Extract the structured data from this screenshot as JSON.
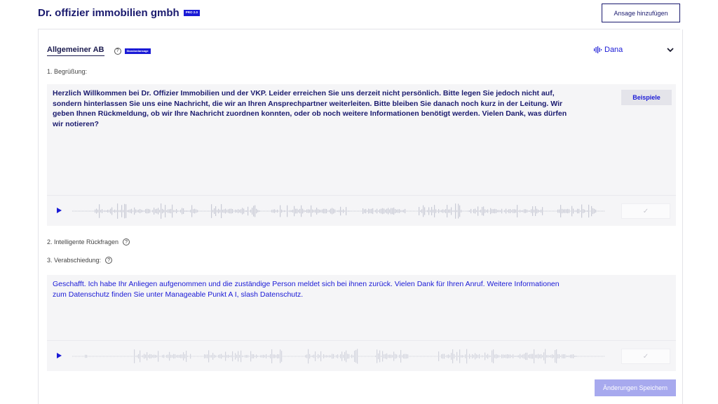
{
  "header": {
    "company_name": "Dr. offizier immobilien gmbh",
    "pro_badge": "PRO 2.0",
    "add_button": "Ansage hinzufügen"
  },
  "ansage": {
    "title": "Allgemeiner AB",
    "help_glyph": "?",
    "standard_badge": "Standardansage",
    "voice_name": "Dana",
    "sections": {
      "greeting_label": "1. Begrüßung:",
      "greeting_text": "Herzlich Willkommen bei Dr. Offizier Immobilien und der VKP. Leider erreichen Sie uns derzeit nicht persönlich. Bitte legen Sie jedoch nicht auf, sondern hinterlassen Sie uns eine Nachricht, die wir an Ihren Ansprechpartner weiterleiten. Bitte bleiben Sie danach noch kurz in der Leitung. Wir geben Ihnen Rückmeldung, ob wir Ihre Nachricht zuordnen konnten, oder ob noch weitere Informationen benötigt werden. Vielen Dank, was dürfen wir notieren?",
      "examples_button": "Beispiele",
      "questions_label": "2. Intelligente Rückfragen",
      "farewell_label": "3. Verabschiedung:",
      "farewell_text": "Geschafft. Ich habe Ihr Anliegen aufgenommen und die zuständige Person meldet sich bei ihnen zurück. Vielen Dank für Ihren Anruf.  Weitere Informationen zum Datenschutz finden Sie unter Manageable Punkt A I, slash Datenschutz.",
      "check_glyph": "✓"
    },
    "save_button": "Änderungen Speichern"
  },
  "colors": {
    "accent": "#1a1ad6",
    "navy": "#1a1a6e",
    "panel": "#f5f5f7",
    "save_disabled": "#a7a9ee"
  }
}
